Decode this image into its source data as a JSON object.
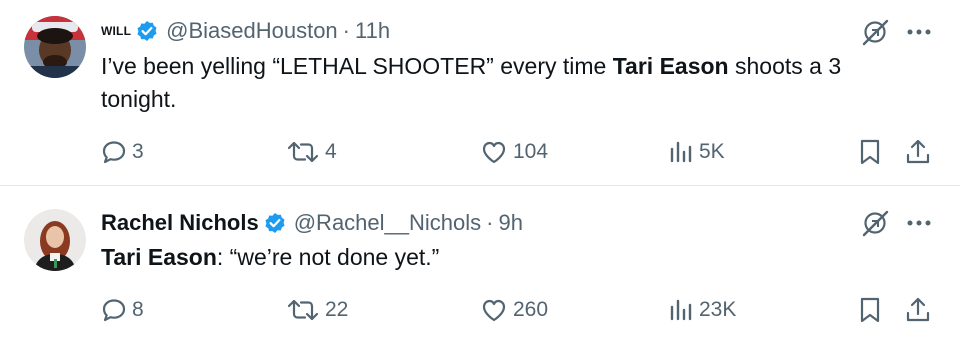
{
  "tweets": [
    {
      "display_name": "WILL",
      "handle": "@BiasedHouston",
      "separator": "·",
      "time": "11h",
      "text_before": "I’ve been yelling “LETHAL SHOOTER” every time ",
      "text_bold": "Tari Eason",
      "text_after": " shoots a 3 tonight.",
      "replies": "3",
      "reposts": "4",
      "likes": "104",
      "views": "5K"
    },
    {
      "display_name": "Rachel Nichols",
      "handle": "@Rachel__Nichols",
      "separator": "·",
      "time": "9h",
      "text_bold": "Tari Eason",
      "text_after": ": “we’re not done yet.”",
      "replies": "8",
      "reposts": "22",
      "likes": "260",
      "views": "23K"
    }
  ],
  "colors": {
    "text": "#0f1419",
    "secondary": "#536471",
    "verified": "#1d9bf0",
    "divider": "#e6e9ec"
  },
  "icons": [
    "verified-badge-icon",
    "grok-icon",
    "more-icon",
    "reply-icon",
    "repost-icon",
    "like-icon",
    "views-icon",
    "bookmark-icon",
    "share-icon"
  ]
}
